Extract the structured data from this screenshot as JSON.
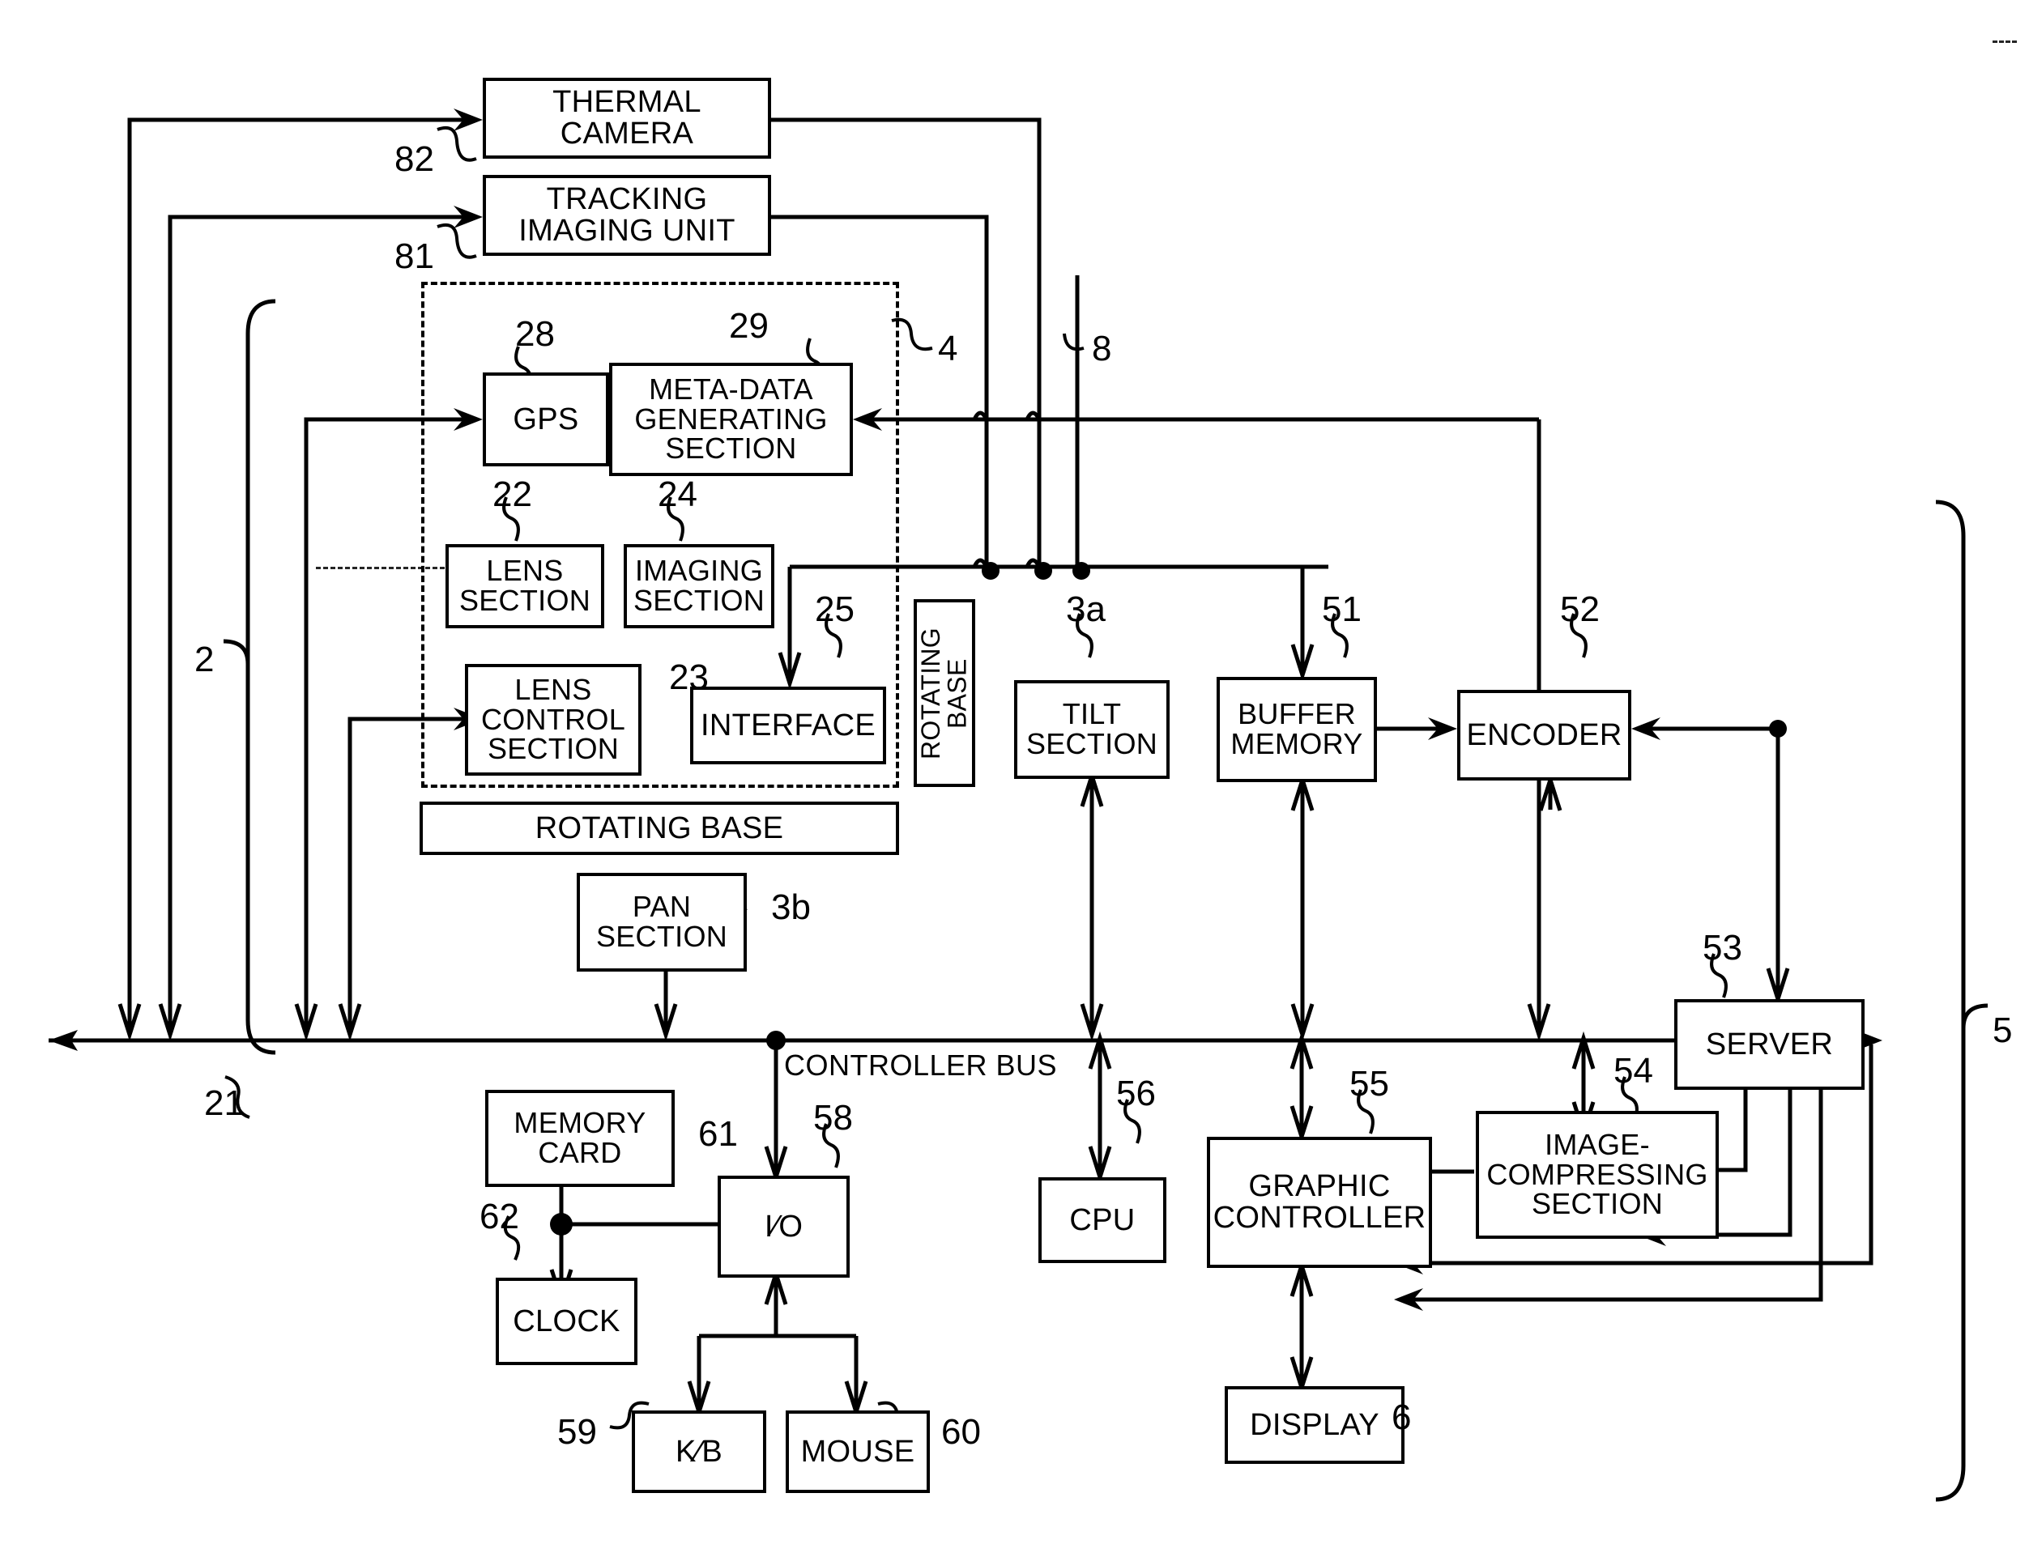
{
  "figure": {
    "type": "patent-block-diagram",
    "title": "Imaging and monitoring system block diagram",
    "bus_label": "CONTROLLER BUS",
    "line_color": "#000000",
    "background_color": "#ffffff"
  },
  "blocks": [
    {
      "id": "thermal-camera",
      "label": "THERMAL\nCAMERA",
      "ref": "82"
    },
    {
      "id": "tracking-imaging-unit",
      "label": "TRACKING\nIMAGING UNIT",
      "ref": "81"
    },
    {
      "id": "gps",
      "label": "GPS",
      "ref": "28"
    },
    {
      "id": "meta-data-generating",
      "label": "META-DATA\nGENERATING\nSECTION",
      "ref": "29"
    },
    {
      "id": "lens-section",
      "label": "LENS\nSECTION",
      "ref": "22"
    },
    {
      "id": "imaging-section",
      "label": "IMAGING\nSECTION",
      "ref": "24"
    },
    {
      "id": "lens-control-section",
      "label": "LENS\nCONTROL\nSECTION",
      "ref": "23"
    },
    {
      "id": "interface",
      "label": "INTERFACE",
      "ref": "25"
    },
    {
      "id": "rotating-base-vert",
      "label": "ROTATING\nBASE",
      "ref": ""
    },
    {
      "id": "tilt-section",
      "label": "TILT\nSECTION",
      "ref": "3a"
    },
    {
      "id": "buffer-memory",
      "label": "BUFFER\nMEMORY",
      "ref": "51"
    },
    {
      "id": "encoder",
      "label": "ENCODER",
      "ref": "52"
    },
    {
      "id": "rotating-base-wide",
      "label": "ROTATING BASE",
      "ref": ""
    },
    {
      "id": "pan-section",
      "label": "PAN\nSECTION",
      "ref": "3b"
    },
    {
      "id": "server",
      "label": "SERVER",
      "ref": "53"
    },
    {
      "id": "image-compressing",
      "label": "IMAGE-\nCOMPRESSING\nSECTION",
      "ref": "54"
    },
    {
      "id": "graphic-controller",
      "label": "GRAPHIC\nCONTROLLER",
      "ref": "55"
    },
    {
      "id": "cpu",
      "label": "CPU",
      "ref": "56"
    },
    {
      "id": "display",
      "label": "DISPLAY",
      "ref": "6"
    },
    {
      "id": "memory-card",
      "label": "MEMORY\nCARD",
      "ref": "61"
    },
    {
      "id": "clock",
      "label": "CLOCK",
      "ref": "62"
    },
    {
      "id": "io",
      "label": "I∕O",
      "ref": "58"
    },
    {
      "id": "keyboard",
      "label": "K∕B",
      "ref": "59"
    },
    {
      "id": "mouse",
      "label": "MOUSE",
      "ref": "60"
    }
  ],
  "reference_numerals": {
    "n82": "82",
    "n81": "81",
    "n28": "28",
    "n29": "29",
    "n4": "4",
    "n8": "8",
    "n22": "22",
    "n24": "24",
    "n23": "23",
    "n25": "25",
    "n2": "2",
    "n3a": "3a",
    "n51": "51",
    "n52": "52",
    "n3b": "3b",
    "n21": "21",
    "n61": "61",
    "n62": "62",
    "n58": "58",
    "n59": "59",
    "n60": "60",
    "n56": "56",
    "n55": "55",
    "n54": "54",
    "n53": "53",
    "n5": "5",
    "n6": "6"
  }
}
